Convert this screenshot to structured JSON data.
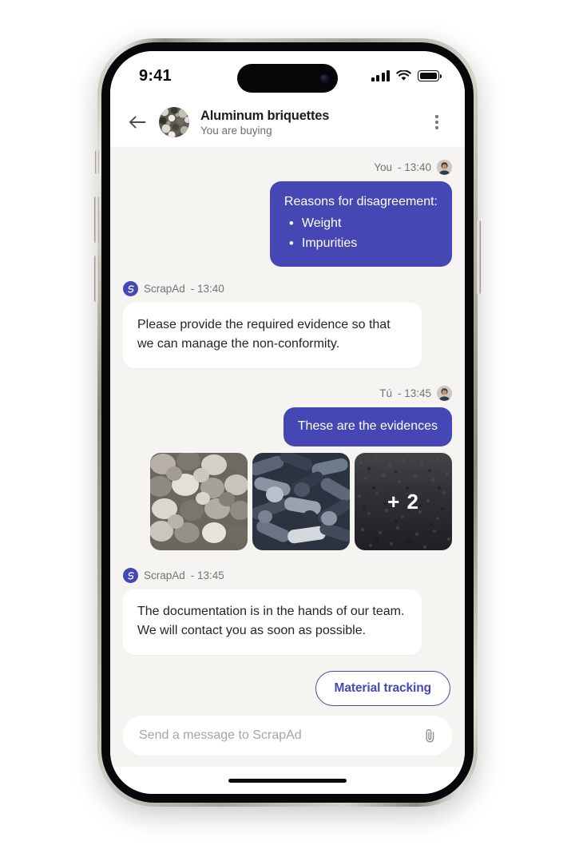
{
  "status_bar": {
    "time": "9:41",
    "signal_icon": "cellular-signal-icon",
    "wifi_icon": "wifi-icon",
    "battery_icon": "battery-full-icon"
  },
  "header": {
    "back_icon": "back-arrow-icon",
    "avatar_alt": "aluminum-briquettes-thumbnail",
    "title": "Aluminum briquettes",
    "subtitle": "You are buying",
    "menu_icon": "kebab-menu-icon"
  },
  "theme": {
    "accent": "#4548b4",
    "chat_background": "#f5f4f1",
    "incoming_bubble": "#ffffff",
    "muted_text": "#73737b",
    "body_text": "#24242a"
  },
  "messages": [
    {
      "id": "msg-1",
      "direction": "outgoing",
      "sender": "You",
      "separator": "-",
      "time": "13:40",
      "avatar": "user-avatar",
      "heading": "Reasons for disagreement:",
      "bullets": [
        "Weight",
        "Impurities"
      ]
    },
    {
      "id": "msg-2",
      "direction": "incoming",
      "sender": "ScrapAd",
      "separator": "-",
      "time": "13:40",
      "avatar": "scrapad-logo-icon",
      "text": "Please provide the required evidence so that we can manage the non-conformity."
    },
    {
      "id": "msg-3",
      "direction": "outgoing",
      "sender": "Tú",
      "separator": "-",
      "time": "13:45",
      "avatar": "user-avatar",
      "text": "These are the evidences"
    },
    {
      "id": "msg-4",
      "direction": "incoming",
      "sender": "ScrapAd",
      "separator": "-",
      "time": "13:45",
      "avatar": "scrapad-logo-icon",
      "text": "The documentation is in the hands of our team. We will contact you as soon as possible."
    }
  ],
  "gallery": {
    "thumbnails": [
      {
        "id": "thumb-1",
        "alt": "light-gray-metal-briquettes-photo",
        "overlay": null
      },
      {
        "id": "thumb-2",
        "alt": "dark-blue-metal-cylinders-photo",
        "overlay": null
      },
      {
        "id": "thumb-3",
        "alt": "dark-granular-material-photo",
        "overlay": "+ 2"
      }
    ]
  },
  "actions": {
    "material_tracking_label": "Material tracking"
  },
  "composer": {
    "placeholder": "Send a message to ScrapAd",
    "value": "",
    "attach_icon": "paperclip-icon"
  },
  "home_indicator": "home-indicator-bar"
}
